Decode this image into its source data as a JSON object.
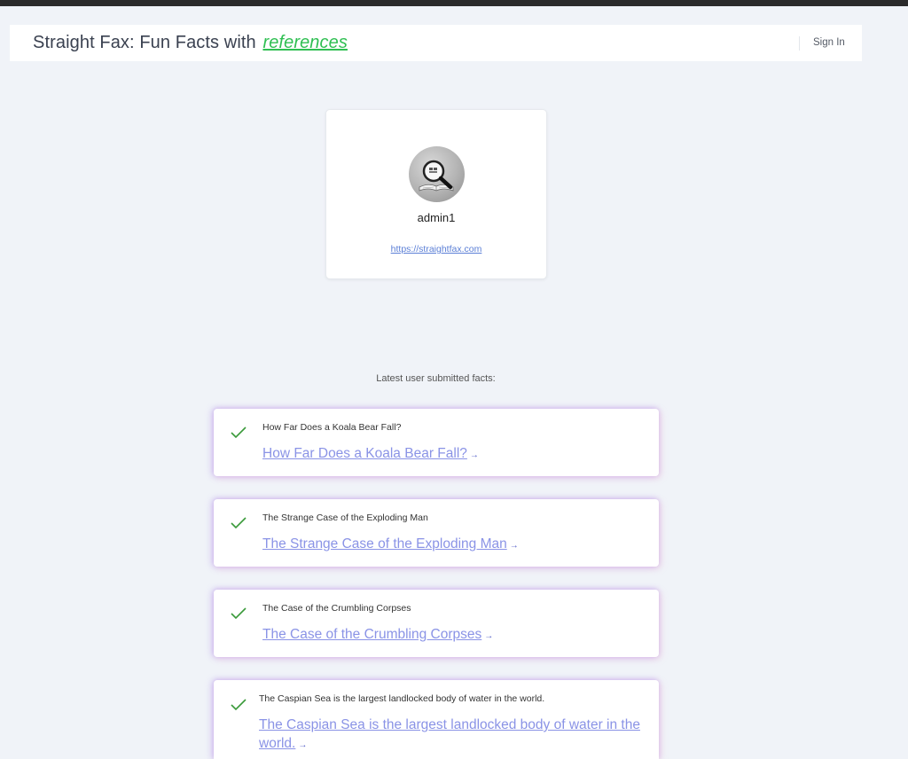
{
  "header": {
    "brand_prefix": "Straight Fax:  Fun Facts with",
    "brand_highlight": "references",
    "signin_label": "Sign In"
  },
  "profile": {
    "avatar_icon": "magnifier-book-icon",
    "username": "admin1",
    "website": "https://straightfax.com"
  },
  "facts_section": {
    "heading": "Latest user submitted facts:"
  },
  "facts": [
    {
      "title": "How Far Does a Koala Bear Fall?",
      "link": "How Far Does a Koala Bear Fall?"
    },
    {
      "title": "The Strange Case of the Exploding Man",
      "link": "The Strange Case of the Exploding Man"
    },
    {
      "title": "The Case of the Crumbling Corpses",
      "link": "The Case of the Crumbling Corpses"
    },
    {
      "title": "The Caspian Sea is the largest landlocked body of water in the world.",
      "link": "The Caspian Sea is the largest landlocked body of water in the world."
    }
  ],
  "colors": {
    "accent_green": "#2fbf52",
    "link_blue": "#8a93e6",
    "check_green": "#3a9a3a"
  },
  "icons": {
    "check": "check-icon",
    "arrow": "arrow-right-icon"
  }
}
